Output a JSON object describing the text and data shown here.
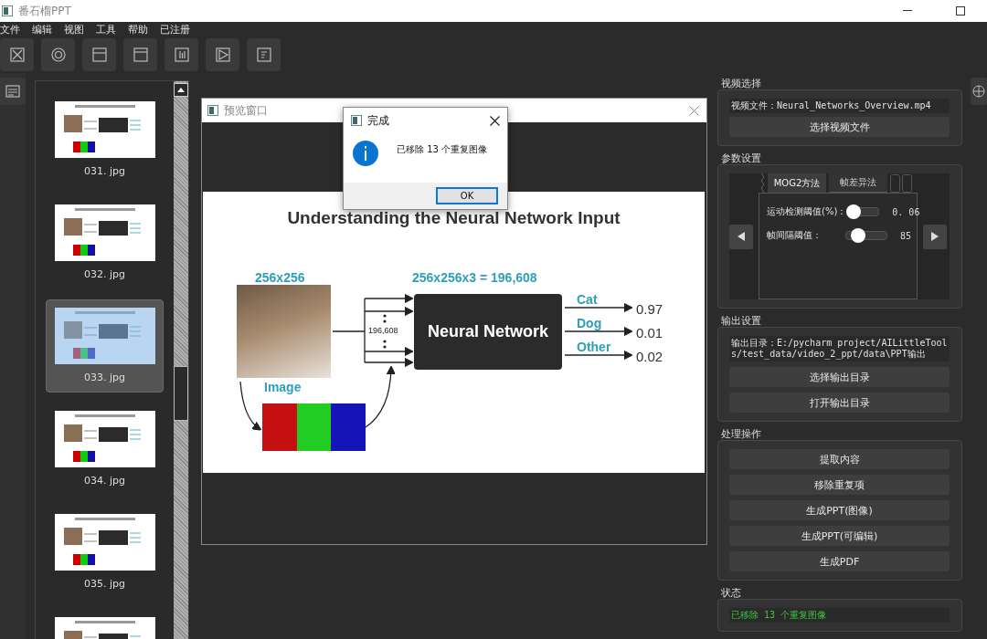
{
  "window": {
    "title": "番石榴PPT"
  },
  "menu": [
    "文件",
    "编辑",
    "视图",
    "工具",
    "帮助",
    "已注册"
  ],
  "thumbnails": [
    {
      "label": "031. jpg",
      "selected": false
    },
    {
      "label": "032. jpg",
      "selected": false
    },
    {
      "label": "033. jpg",
      "selected": true
    },
    {
      "label": "034. jpg",
      "selected": false
    },
    {
      "label": "035. jpg",
      "selected": false
    },
    {
      "selected": false
    }
  ],
  "preview": {
    "title": "预览窗口",
    "slide": {
      "title": "Understanding the Neural Network Input",
      "image_size": "256x256",
      "image_label": "Image",
      "input_size": "256x256x3 = 196,608",
      "input_count": "196,608",
      "network": "Neural Network",
      "outputs": [
        {
          "label": "Cat",
          "value": "0.97"
        },
        {
          "label": "Dog",
          "value": "0.01"
        },
        {
          "label": "Other",
          "value": "0.02"
        }
      ]
    }
  },
  "dialog": {
    "title": "完成",
    "message": "已移除 13 个重复图像",
    "button": "OK"
  },
  "video": {
    "heading": "视频选择",
    "file": "视频文件：Neural_Networks_Overview.mp4",
    "button": "选择视频文件"
  },
  "params": {
    "heading": "参数设置",
    "tabs": [
      {
        "label": "MOG2方法",
        "selected": true
      },
      {
        "label": "帧差异法",
        "selected": false
      }
    ],
    "sliders": [
      {
        "label": "运动检测阈值(%)：",
        "level": 0.2,
        "reading": "0. 06"
      },
      {
        "label": "帧间隔阈值：",
        "level": 0.3,
        "reading": "85"
      }
    ]
  },
  "output": {
    "heading": "输出设置",
    "path": "输出目录：E:/pycharm project/AILittleTools/test_data/video_2_ppt/data\\PPT输出",
    "buttons": [
      "选择输出目录",
      "打开输出目录"
    ]
  },
  "actions": {
    "heading": "处理操作",
    "buttons": [
      "提取内容",
      "移除重复项",
      "生成PPT(图像)",
      "生成PPT(可编辑)",
      "生成PDF"
    ]
  },
  "status": {
    "heading": "状态",
    "text": "已移除 13 个重复图像"
  }
}
